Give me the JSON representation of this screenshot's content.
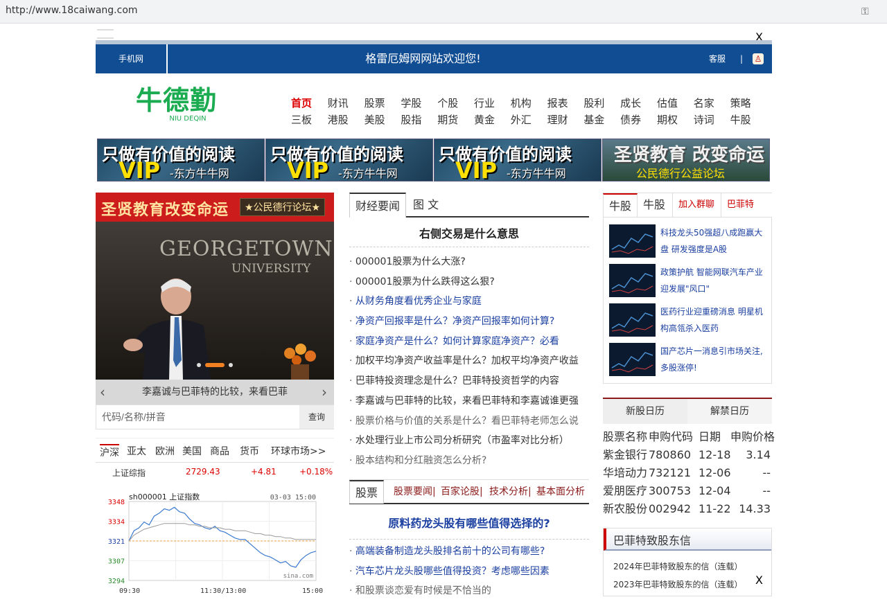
{
  "browser": {
    "url": "http://www.18caiwang.com"
  },
  "close_label": "X",
  "topbar": {
    "mobile": "手机网",
    "welcome": "格雷厄姆网网站欢迎您!",
    "service": "客服",
    "separator": "|"
  },
  "logo": {
    "name": "牛德勤",
    "sub": "NIU DEQIN"
  },
  "nav": {
    "row1": [
      "首页",
      "财讯",
      "股票",
      "学股",
      "个股",
      "行业",
      "机构",
      "报表",
      "股利",
      "成长",
      "估值",
      "名家",
      "策略"
    ],
    "row2": [
      "三板",
      "港股",
      "美股",
      "股指",
      "期货",
      "黄金",
      "外汇",
      "理财",
      "基金",
      "债券",
      "期权",
      "诗词",
      "牛股"
    ],
    "active": "首页"
  },
  "banners": {
    "vip_line1": "只做有价值的阅读",
    "vip_line2": "VIP",
    "vip_line3": "-东方牛牛网",
    "sx_line1": "圣贤教育 改变命运",
    "sx_line2": "公民德行公益论坛"
  },
  "redbanner": {
    "title": "圣贤教育改变命运",
    "badge": "★公民德行论坛★"
  },
  "photo": {
    "line1": "GEORGETOWN",
    "line2": "UNIVERSITY"
  },
  "slider": {
    "caption": "李嘉诚与巴菲特的比较，来看巴菲",
    "prev": "‹",
    "next": "›"
  },
  "search": {
    "placeholder": "代码/名称/拼音",
    "button": "查询"
  },
  "market": {
    "tabs": [
      "沪深",
      "亚太",
      "欧洲",
      "美国",
      "商品",
      "货币",
      "环球市场>>"
    ],
    "index_name": "上证综指",
    "index_value": "2729.43",
    "index_change": "+4.81",
    "index_pct": "+0.18%"
  },
  "chart_data": {
    "type": "line",
    "title": "sh000001 上证指数",
    "date": "03-03 15:00",
    "source": "sina.com",
    "ylim": [
      3294,
      3348
    ],
    "yticks": [
      "3348",
      "3334",
      "3321",
      "3307",
      "3294"
    ],
    "xticks": [
      "09:30",
      "11:30/13:00",
      "15:00"
    ],
    "reference": 3321,
    "series": [
      {
        "values": [
          3321,
          3328,
          3330,
          3334,
          3332,
          3338,
          3340,
          3343,
          3342,
          3344,
          3341,
          3340,
          3336,
          3333,
          3332,
          3330,
          3329,
          3331,
          3328,
          3327,
          3325,
          3323,
          3322,
          3322,
          3319,
          3316,
          3313,
          3311,
          3310,
          3308,
          3306,
          3307,
          3304,
          3303,
          3308,
          3311,
          3313,
          3314
        ]
      },
      {
        "values": [
          3321,
          3325,
          3327,
          3329,
          3330,
          3331,
          3332,
          3333,
          3333,
          3333,
          3333,
          3333,
          3332,
          3332,
          3331,
          3331,
          3330,
          3330,
          3330,
          3329,
          3329,
          3328,
          3328,
          3328,
          3327,
          3326,
          3326,
          3325,
          3325,
          3324,
          3324,
          3323,
          3323,
          3322,
          3322,
          3322,
          3322,
          3322
        ]
      }
    ]
  },
  "middle": {
    "tabs": [
      "财经要闻",
      "图 文"
    ],
    "headline": "右侧交易是什么意思",
    "news": [
      "000001股票为什么大涨?",
      "000001股票为什么跌得这么狠?",
      "从财务角度看优秀企业与家庭",
      "净资产回报率是什么？净资产回报率如何计算?",
      "家庭净资产是什么？如何计算家庭净资产？必看",
      "加权平均净资产收益率是什么？加权平均净资产收益",
      "巴菲特投资理念是什么？巴菲特投资哲学的内容",
      "李嘉诚与巴菲特的比较，来看巴菲特和李嘉诚谁更强",
      "股票价格与价值的关系是什么？看巴菲特老师怎么说",
      "水处理行业上市公司分析研究（市盈率对比分析）",
      "股本结构和分红融资怎么分析?"
    ],
    "news_colors": [
      "#333",
      "#333",
      "#1a3fa0",
      "#1a3fa0",
      "#1a3fa0",
      "#333",
      "#333",
      "#333",
      "#666",
      "#333",
      "#666"
    ]
  },
  "stock": {
    "tab": "股票",
    "subs": [
      "股票要闻|",
      "百家论股|",
      "技术分析|",
      "基本面分析"
    ],
    "headline": "原料药龙头股有哪些值得选择的?",
    "news": [
      "高端装备制造龙头股排名前十的公司有哪些?",
      "汽车芯片龙头股哪些值得投资？考虑哪些因素",
      "和股票谈恋爱有时候是不恰当的"
    ],
    "news_colors": [
      "#1a3fa0",
      "#1a3fa0",
      "#666"
    ]
  },
  "right": {
    "tabs": [
      "牛股",
      "牛股",
      "加入群聊",
      "巴菲特"
    ],
    "items": [
      "科技龙头50强超八成跑赢大盘 研发强度是A股",
      "政策护航 智能网联汽车产业迎发展\"风口\"",
      "医药行业迎重磅消息 明星机构高瓴杀入医药",
      "国产芯片一消息引市场关注,多股涨停!"
    ]
  },
  "calendar": {
    "tabs": [
      "新股日历",
      "解禁日历"
    ],
    "headers": [
      "股票名称",
      "申购代码",
      "日期",
      "申购价格"
    ],
    "rows": [
      [
        "紫金银行",
        "780860",
        "12-18",
        "3.14"
      ],
      [
        "华培动力",
        "732121",
        "12-06",
        "--"
      ],
      [
        "爱朋医疗",
        "300753",
        "12-04",
        "--"
      ],
      [
        "新农股份",
        "002942",
        "11-22",
        "14.33"
      ]
    ]
  },
  "buffett": {
    "title": "巴菲特致股东信",
    "items": [
      "2024年巴菲特致股东的信（连载）",
      "2023年巴菲特致股东的信（连载）"
    ]
  },
  "colors": {
    "topbar": "#114d93",
    "logo_green": "#1bab51",
    "up_red": "#dd0000",
    "link_blue": "#1a3fa0"
  }
}
